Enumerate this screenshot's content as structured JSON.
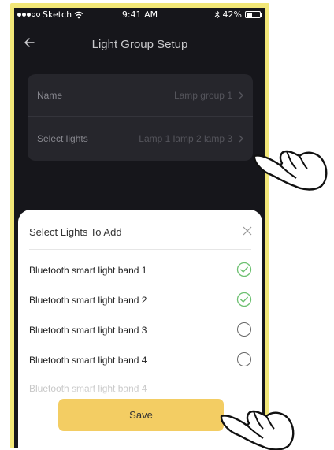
{
  "status_bar": {
    "carrier": "Sketch",
    "time": "9:41 AM",
    "battery": "42%",
    "battery_level": 0.42
  },
  "nav": {
    "title": "Light Group Setup"
  },
  "settings": {
    "name_label": "Name",
    "name_value": "Lamp group 1",
    "select_label": "Select lights",
    "select_value": "Lamp 1 lamp 2 lamp 3"
  },
  "sheet": {
    "title": "Select Lights To Add",
    "items": [
      {
        "label": "Bluetooth smart light band 1",
        "checked": true
      },
      {
        "label": "Bluetooth smart light band 2",
        "checked": true
      },
      {
        "label": "Bluetooth smart light band 3",
        "checked": false
      },
      {
        "label": "Bluetooth smart light band 4",
        "checked": false
      },
      {
        "label": "Bluetooth smart light band 4",
        "checked": false,
        "faded": true
      }
    ],
    "save_label": "Save"
  },
  "colors": {
    "frame": "#f2e778",
    "screen_bg": "#16161b",
    "card_bg": "#26262c",
    "accent_button": "#f3cd63",
    "check_green": "#6cc070"
  }
}
